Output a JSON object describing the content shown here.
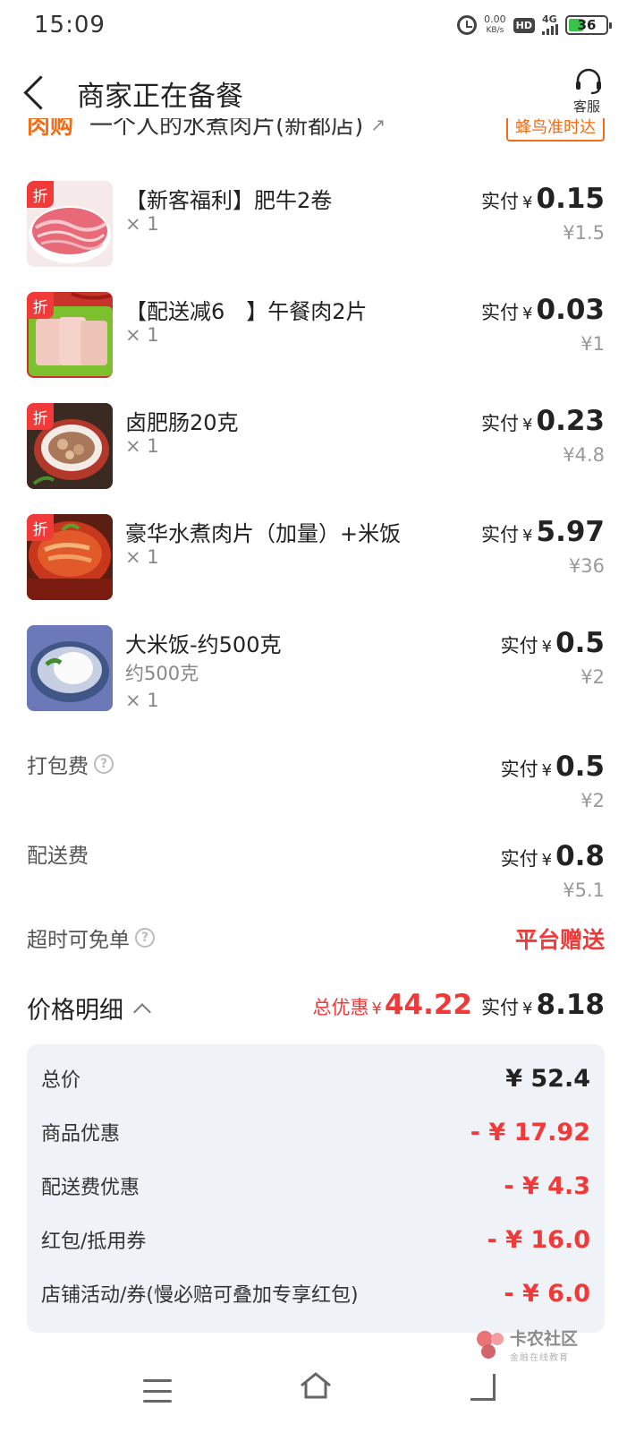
{
  "status_bar": {
    "time": "15:09",
    "net_speed_value": "0.00",
    "net_speed_unit": "KB/s",
    "hd": "HD",
    "network": "4G",
    "battery": "36"
  },
  "header": {
    "title": "商家正在备餐",
    "service_label": "客服"
  },
  "store": {
    "tag": "肉购",
    "name": "一个人的水煮肉片(新都店)",
    "arrow": "↗",
    "delivery_tag": "蜂鸟准时达"
  },
  "labels": {
    "paid_prefix": "实付",
    "currency": "¥",
    "discount_badge": "折"
  },
  "items": [
    {
      "name": "【新客福利】肥牛2卷",
      "qty": "× 1",
      "paid": "0.15",
      "original": "¥1.5"
    },
    {
      "name": "【配送减6　】午餐肉2片",
      "qty": "× 1",
      "paid": "0.03",
      "original": "¥1"
    },
    {
      "name": "卤肥肠20克",
      "qty": "× 1",
      "paid": "0.23",
      "original": "¥4.8"
    },
    {
      "name": "豪华水煮肉片（加量）+米饭",
      "qty": "× 1",
      "paid": "5.97",
      "original": "¥36"
    },
    {
      "name": "大米饭-约500克",
      "spec": "约500克",
      "qty": "× 1",
      "paid": "0.5",
      "original": "¥2"
    }
  ],
  "fees": {
    "packing": {
      "label": "打包费",
      "paid": "0.5",
      "original": "¥2"
    },
    "delivery": {
      "label": "配送费",
      "paid": "0.8",
      "original": "¥5.1"
    },
    "overtime": {
      "label": "超时可免单",
      "value": "平台赠送"
    }
  },
  "price_detail": {
    "title": "价格明细",
    "total_discount_label": "总优惠",
    "total_discount": "44.22",
    "total_paid": "8.18",
    "lines": [
      {
        "label": "总价",
        "value": "¥ 52.4"
      },
      {
        "label": "商品优惠",
        "value": "- ¥ 17.92"
      },
      {
        "label": "配送费优惠",
        "value": "- ¥ 4.3"
      },
      {
        "label": "红包/抵用券",
        "value": "- ¥ 16.0"
      },
      {
        "label": "店铺活动/券(慢必赔可叠加专享红包)",
        "value": "- ¥ 6.0"
      }
    ]
  },
  "watermark": {
    "title": "卡农社区",
    "subtitle": "金融在线教育"
  },
  "colors": {
    "accent_red": "#f03a3a",
    "accent_orange": "#f26c16",
    "detail_bg": "#eff2f6"
  }
}
